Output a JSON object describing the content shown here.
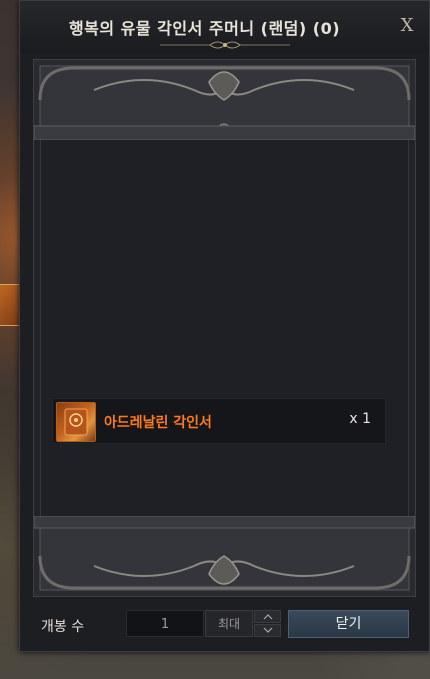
{
  "window": {
    "title": "행복의 유물 각인서 주머니 (랜덤) (0)",
    "close_glyph": "X"
  },
  "item": {
    "name": "아드레날린 각인서",
    "quantity": "x 1",
    "name_color": "#ff7a1a",
    "icon": "engraving-book-icon"
  },
  "footer": {
    "open_count_label": "개봉 수",
    "quantity_value": "1",
    "max_label": "최대",
    "close_label": "닫기"
  },
  "colors": {
    "accent_button": "#34455a",
    "panel_bg": "#1d1e22"
  }
}
